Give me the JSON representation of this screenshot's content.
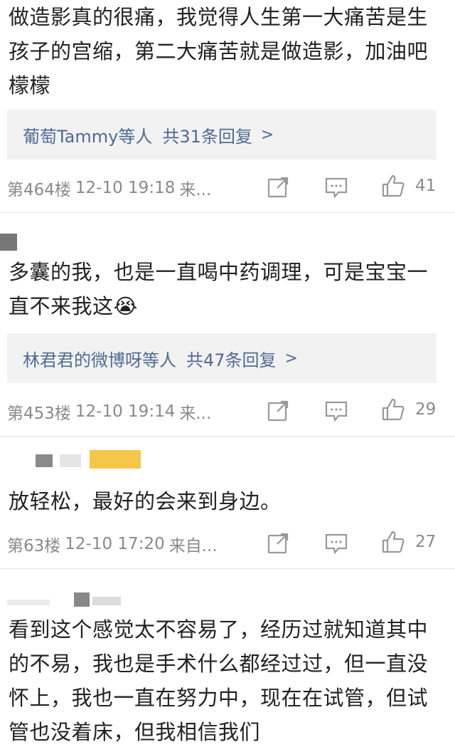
{
  "comments": [
    {
      "text": "做造影真的很痛，我觉得人生第一大痛苦是生孩子的宫缩，第二大痛苦就是做造影，加油吧檬檬",
      "replies": {
        "names": "葡萄Tammy等人",
        "count": "共31条回复",
        "chevron": ">"
      },
      "meta": {
        "floor": "第464楼",
        "time": "12-10 19:18",
        "source": "来..."
      },
      "likes": "41"
    },
    {
      "text": "多囊的我，也是一直喝中药调理，可是宝宝一直不来我这😭",
      "replies": {
        "names": "林君君的微博呀等人",
        "count": "共47条回复",
        "chevron": ">"
      },
      "meta": {
        "floor": "第453楼",
        "time": "12-10 19:14",
        "source": "来..."
      },
      "likes": "29"
    },
    {
      "text": "放轻松，最好的会来到身边。",
      "meta": {
        "floor": "第63楼",
        "time": "12-10 17:20",
        "source": "来自..."
      },
      "likes": "27"
    },
    {
      "text": "看到这个感觉太不容易了，经历过就知道其中的不易，我也是手术什么都经过过，但一直没怀上，我也一直在努力中，现在在试管，但试管也没着床，但我相信我们"
    }
  ],
  "icons": {
    "share": "share-icon",
    "comment": "comment-icon",
    "like": "thumbs-up-icon"
  },
  "colors": {
    "link": "#4f6b95",
    "meta": "#8a8a8a",
    "reply_bg": "#f2f2f2"
  }
}
